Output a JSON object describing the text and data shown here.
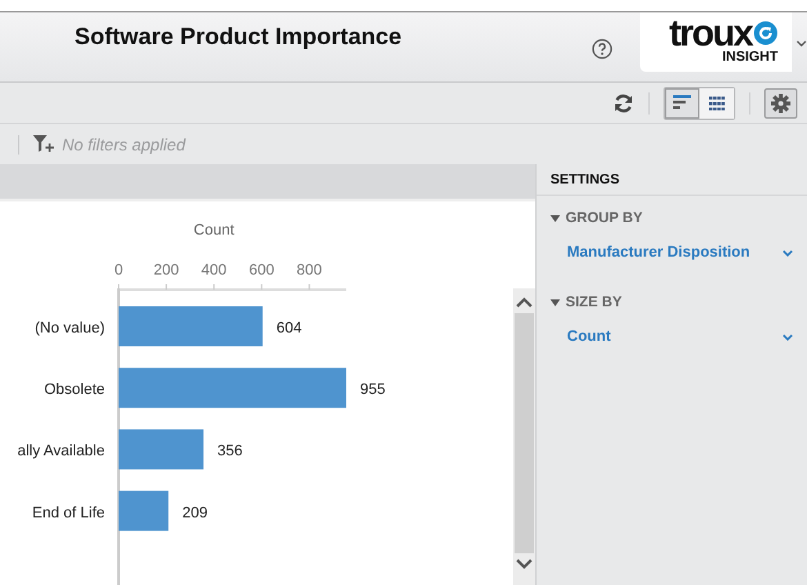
{
  "header": {
    "title": "Software Product Importance",
    "logo": {
      "brand": "troux",
      "sub": "INSIGHT"
    }
  },
  "toolbar": {
    "views": [
      {
        "kind": "bars",
        "selected": true
      },
      {
        "kind": "grid",
        "selected": false
      }
    ]
  },
  "filter_bar": {
    "text": "No filters applied"
  },
  "chart": {
    "chart_data": {
      "type": "bar",
      "orientation": "horizontal",
      "xlabel": "Count",
      "categories": [
        "(No value)",
        "Obsolete",
        "ally Available",
        "End of Life"
      ],
      "values": [
        604,
        955,
        356,
        209
      ],
      "xticks": [
        0,
        200,
        400,
        600,
        800
      ],
      "xlim": [
        0,
        955
      ],
      "data_labels": true
    }
  },
  "settings": {
    "title": "SETTINGS",
    "sections": [
      {
        "label": "GROUP BY",
        "expanded": true,
        "value": "Manufacturer Disposition"
      },
      {
        "label": "SIZE BY",
        "expanded": true,
        "value": "Count"
      }
    ]
  }
}
